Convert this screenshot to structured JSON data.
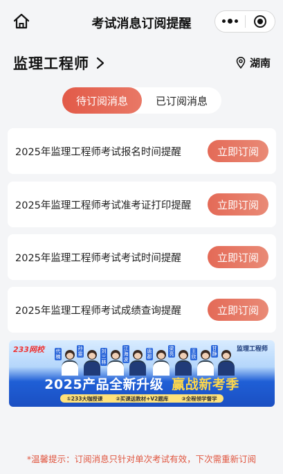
{
  "nav": {
    "title": "考试消息订阅提醒",
    "home_icon": "home-icon",
    "more_icon": "more-dots-icon",
    "close_icon": "mini-program-close-icon"
  },
  "exam": {
    "name": "监理工程师",
    "region": "湖南"
  },
  "tabs": [
    {
      "label": "待订阅消息",
      "active": true
    },
    {
      "label": "已订阅消息",
      "active": false
    }
  ],
  "reminders": [
    {
      "text": "2025年监理工程师考试报名时间提醒",
      "button": "立即订阅"
    },
    {
      "text": "2025年监理工程师考试准考证打印提醒",
      "button": "立即订阅"
    },
    {
      "text": "2025年监理工程师考试考试时间提醒",
      "button": "立即订阅"
    },
    {
      "text": "2025年监理工程师考试成绩查询提醒",
      "button": "立即订阅"
    }
  ],
  "banner": {
    "logo": "233网校",
    "tag": "监理工程师",
    "headline": "2025产品全新升级",
    "headline_highlight": "赢战新考季",
    "features": [
      "①233大咖授课",
      "②买课送教材+V2题库",
      "③全程领学督学"
    ],
    "teacher_tags": [
      "代楠",
      "孙雯",
      "刘三林",
      "江海波",
      "唐郡",
      "梁亮",
      "王欣",
      "甘静"
    ]
  },
  "tip": "*温馨提示：订阅消息只针对单次考试有效，下次需重新订阅",
  "colors": {
    "accent": "#e25a48",
    "button": "#e67a66",
    "background": "#f4f5f7",
    "banner_blue": "#1f5fd6",
    "highlight_yellow": "#ffd84a"
  }
}
